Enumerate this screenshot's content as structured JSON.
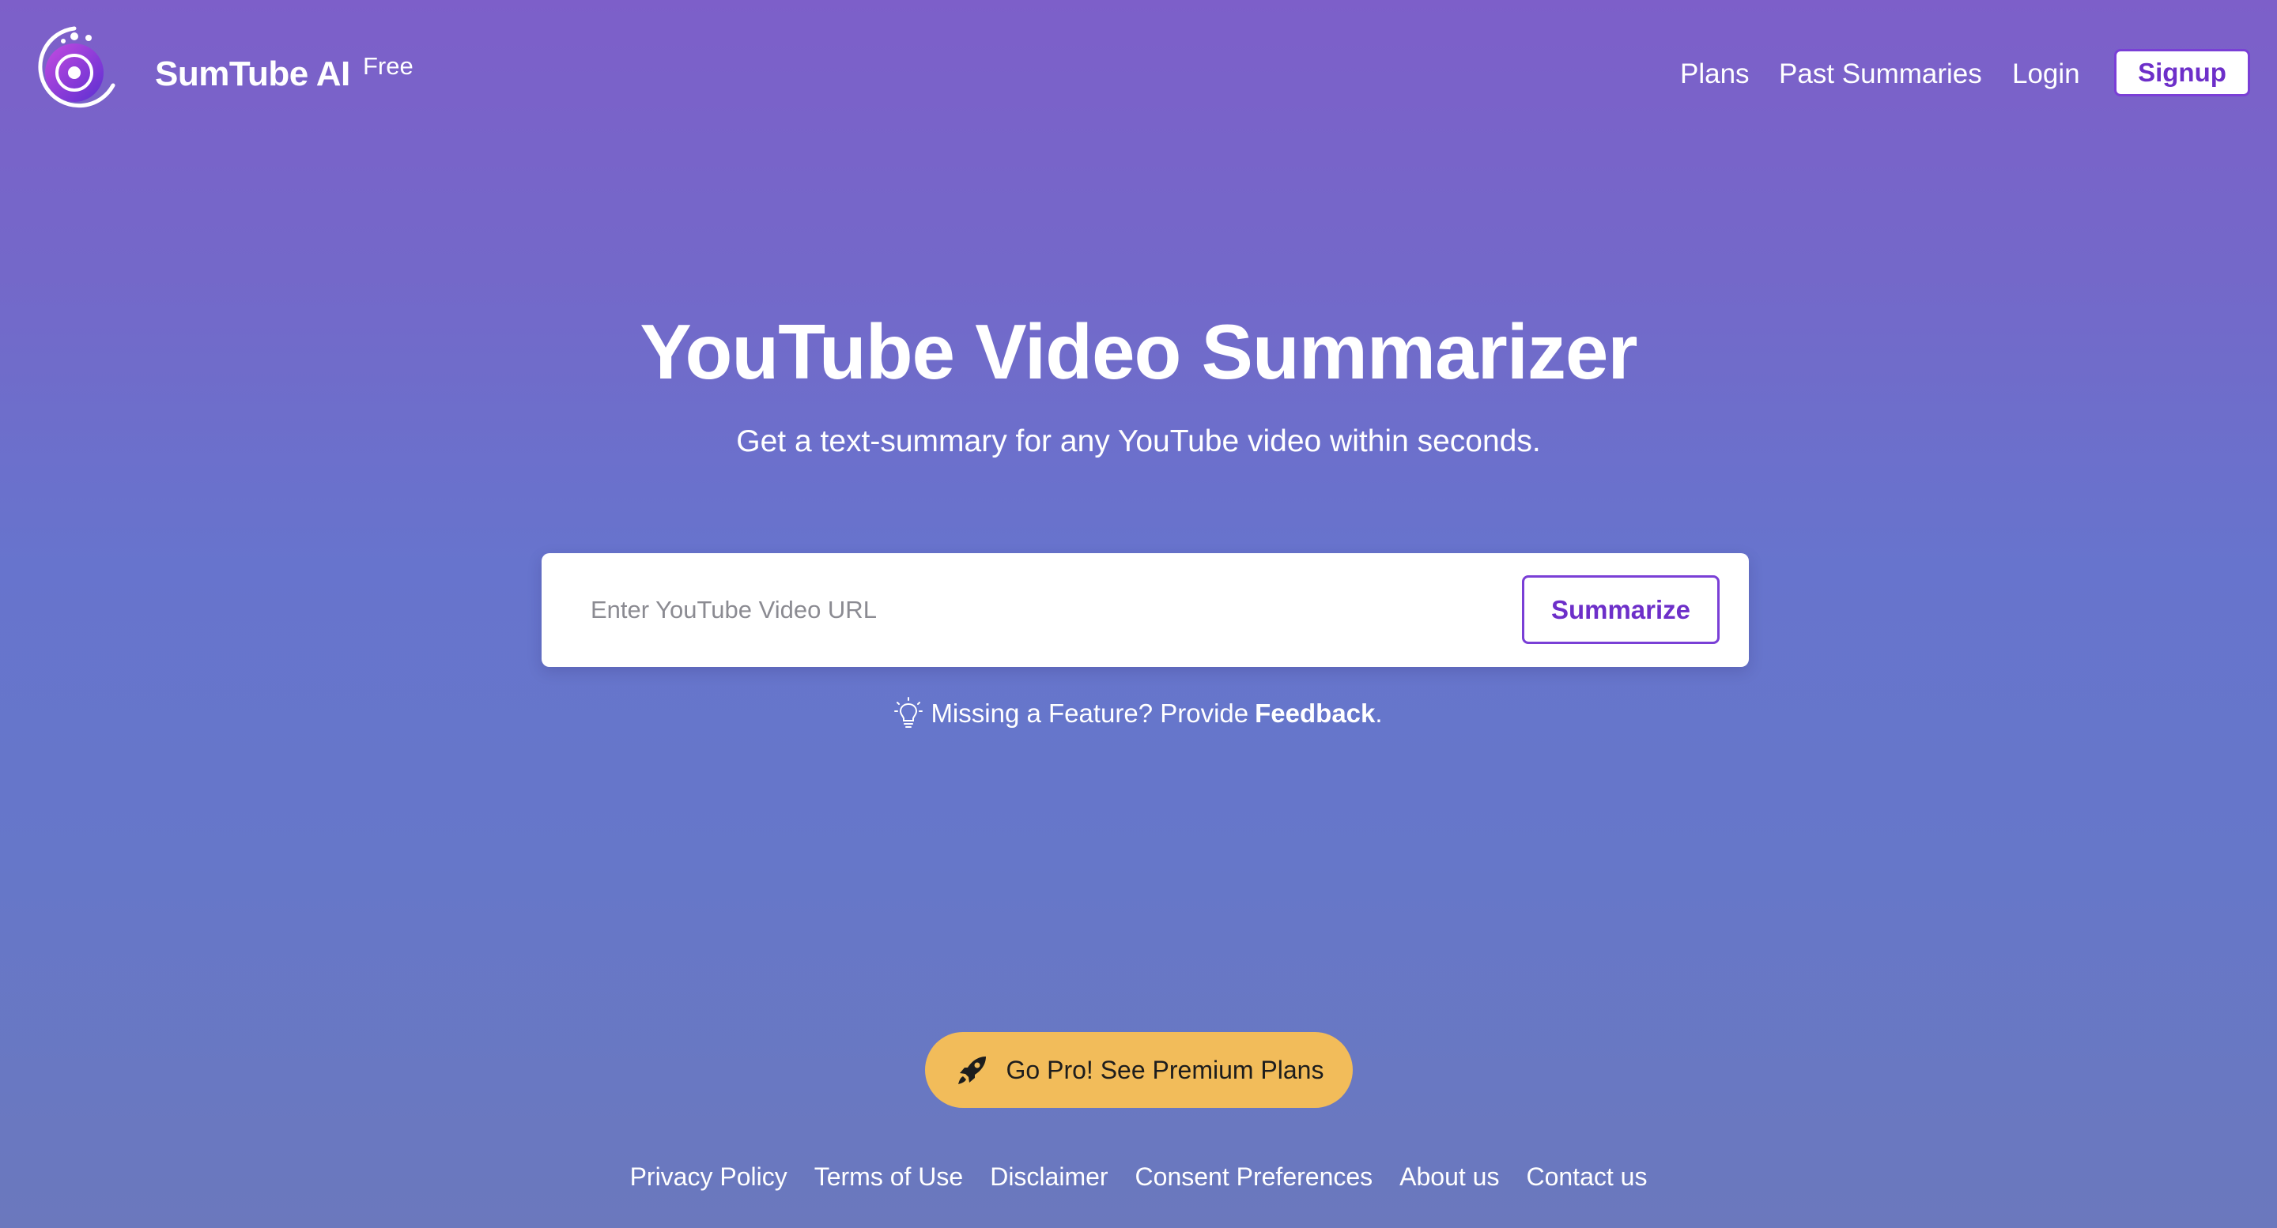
{
  "header": {
    "brand_name": "SumTube AI",
    "brand_badge": "Free",
    "nav": {
      "plans": "Plans",
      "past_summaries": "Past Summaries",
      "login": "Login",
      "signup": "Signup"
    }
  },
  "hero": {
    "title": "YouTube Video Summarizer",
    "subtitle": "Get a text-summary for any YouTube video within seconds."
  },
  "search": {
    "placeholder": "Enter YouTube Video URL",
    "value": "",
    "button_label": "Summarize"
  },
  "feedback": {
    "prefix": "Missing a Feature? Provide",
    "link_label": "Feedback",
    "suffix": ".",
    "icon": "lightbulb-icon"
  },
  "pro": {
    "label": "Go Pro! See Premium Plans",
    "icon": "rocket-icon"
  },
  "footer": {
    "links": [
      "Privacy Policy",
      "Terms of Use",
      "Disclaimer",
      "Consent Preferences",
      "About us",
      "Contact us"
    ]
  },
  "colors": {
    "accent": "#7a3fd6",
    "pro_button": "#f2bc5a",
    "background_top": "#7d5fc9",
    "background_bottom": "#6b78bd"
  }
}
